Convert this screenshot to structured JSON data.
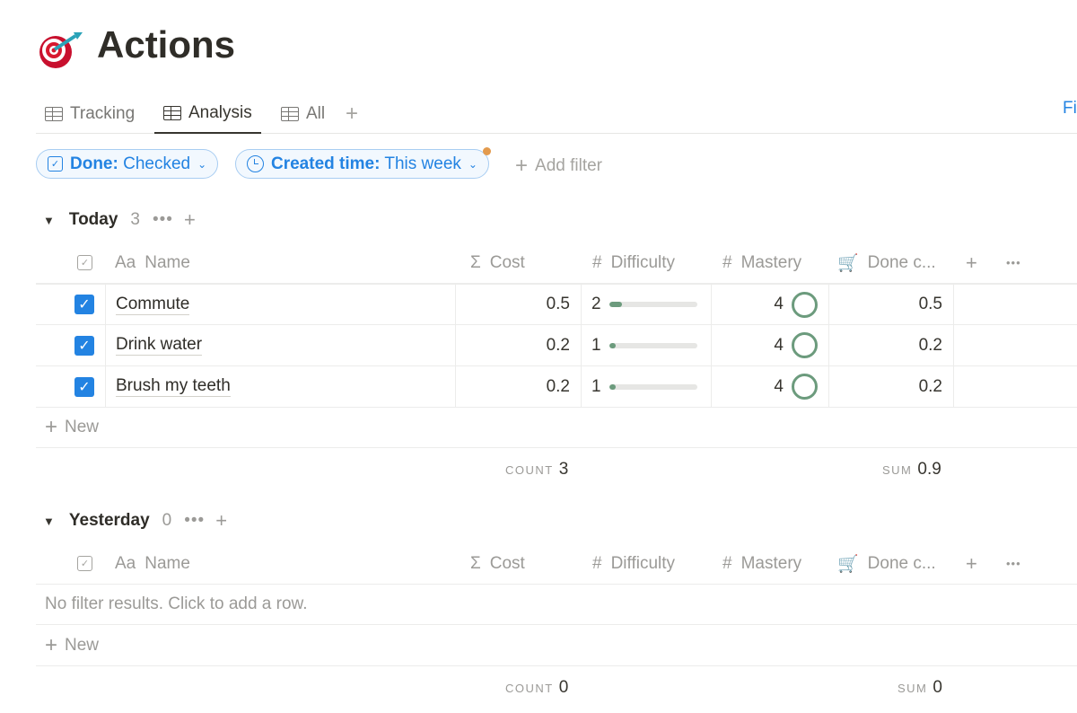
{
  "page": {
    "title": "Actions",
    "icon": "direct-hit-emoji"
  },
  "tabs": [
    {
      "label": "Tracking"
    },
    {
      "label": "Analysis",
      "active": true
    },
    {
      "label": "All"
    }
  ],
  "toolbar": {
    "truncated_label": "Fi"
  },
  "filters": [
    {
      "field": "Done:",
      "value": "Checked",
      "icon": "checkbox-icon"
    },
    {
      "field": "Created time:",
      "value": "This week",
      "icon": "clock-icon"
    }
  ],
  "add_filter": "Add filter",
  "columns": {
    "name": "Name",
    "name_prefix": "Aa",
    "cost": "Cost",
    "difficulty": "Difficulty",
    "mastery": "Mastery",
    "done": "Done c..."
  },
  "groups": [
    {
      "name": "Today",
      "count": "3",
      "rows": [
        {
          "name": "Commute",
          "done": true,
          "cost": "0.5",
          "difficulty": "2",
          "difficulty_fill": 0.15,
          "mastery": "4",
          "mastery_fill": 1,
          "done_cost": "0.5"
        },
        {
          "name": "Drink water",
          "done": true,
          "cost": "0.2",
          "difficulty": "1",
          "difficulty_fill": 0.05,
          "mastery": "4",
          "mastery_fill": 1,
          "done_cost": "0.2"
        },
        {
          "name": "Brush my teeth",
          "done": true,
          "cost": "0.2",
          "difficulty": "1",
          "difficulty_fill": 0.05,
          "mastery": "4",
          "mastery_fill": 1,
          "done_cost": "0.2"
        }
      ],
      "count_label": "COUNT",
      "count_value": "3",
      "sum_label": "SUM",
      "sum_value": "0.9"
    },
    {
      "name": "Yesterday",
      "count": "0",
      "empty_text": "No filter results. Click to add a row.",
      "count_label": "COUNT",
      "count_value": "0",
      "sum_label": "SUM",
      "sum_value": "0"
    }
  ],
  "new_label": "New",
  "colors": {
    "accent": "#2383e2",
    "progress": "#6c9b7d",
    "dot": "#e39a4d"
  }
}
